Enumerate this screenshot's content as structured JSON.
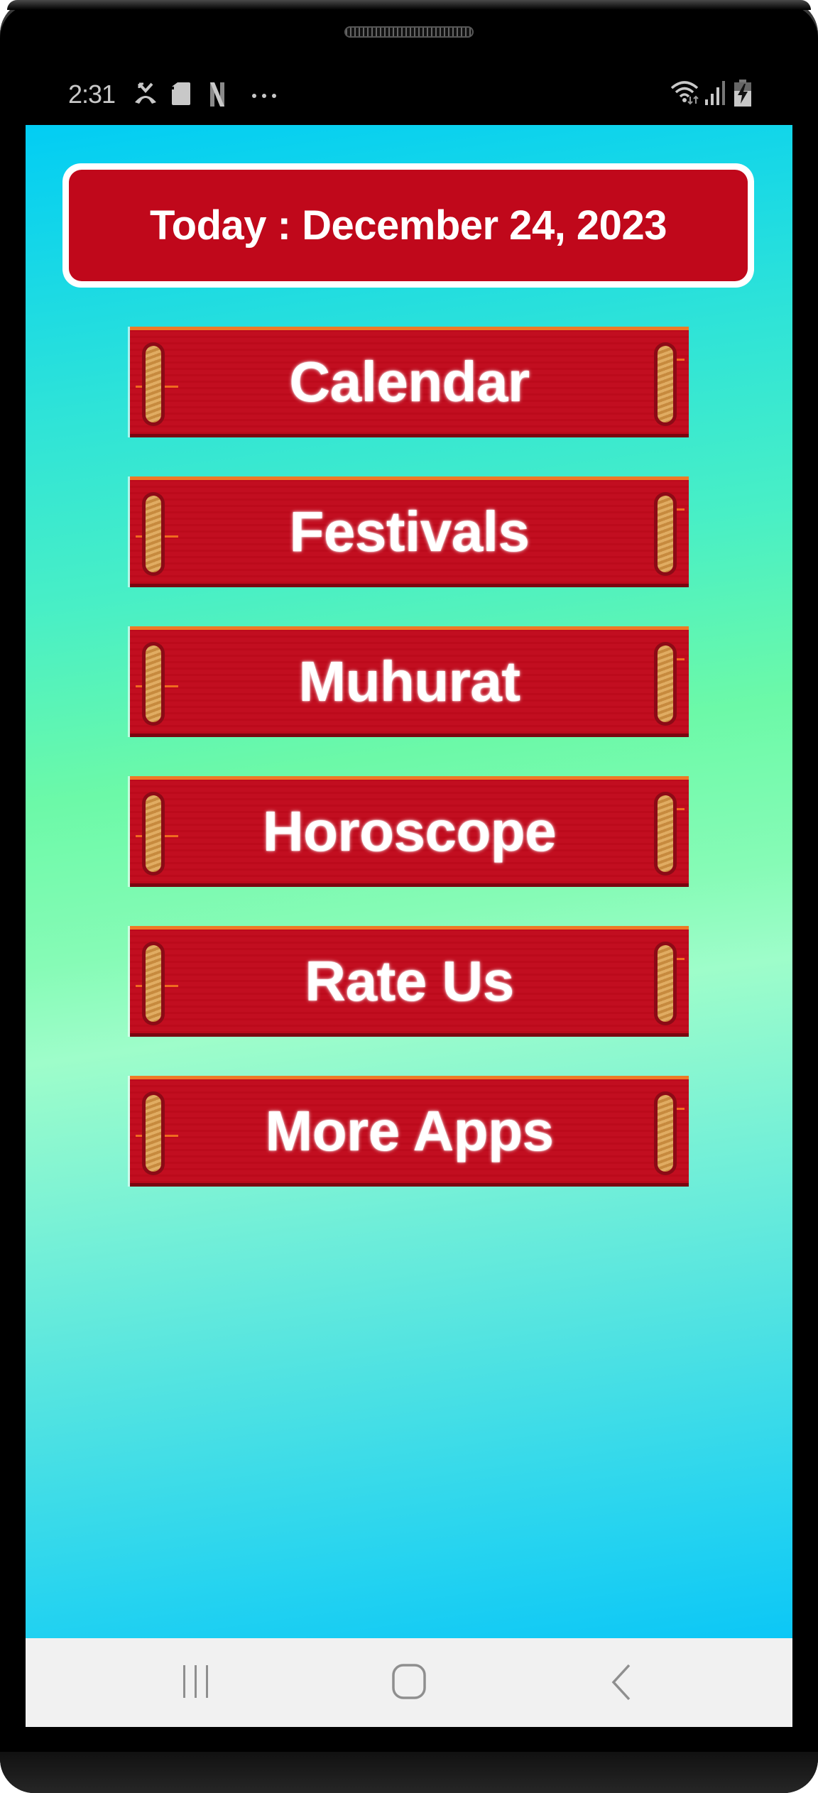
{
  "status_bar": {
    "time": "2:31",
    "left_icons": [
      "missed-call-icon",
      "sd-card-icon",
      "netflix-icon",
      "more-notifications-icon"
    ],
    "right_icons": [
      "wifi-icon",
      "signal-icon",
      "battery-charging-icon"
    ]
  },
  "header": {
    "date_text": "Today : December 24, 2023"
  },
  "menu": {
    "items": [
      {
        "label": "Calendar"
      },
      {
        "label": "Festivals"
      },
      {
        "label": "Muhurat"
      },
      {
        "label": "Horoscope"
      },
      {
        "label": "Rate Us"
      },
      {
        "label": "More Apps"
      }
    ]
  },
  "nav_bar": {
    "buttons": [
      "recent-apps",
      "home",
      "back"
    ]
  },
  "colors": {
    "banner_red": "#c0081b",
    "button_red": "#c10a1c",
    "gradient_cyan": "#02cdf4",
    "gradient_green": "#6cf9a8",
    "nav_bg": "#f1f1f1"
  }
}
